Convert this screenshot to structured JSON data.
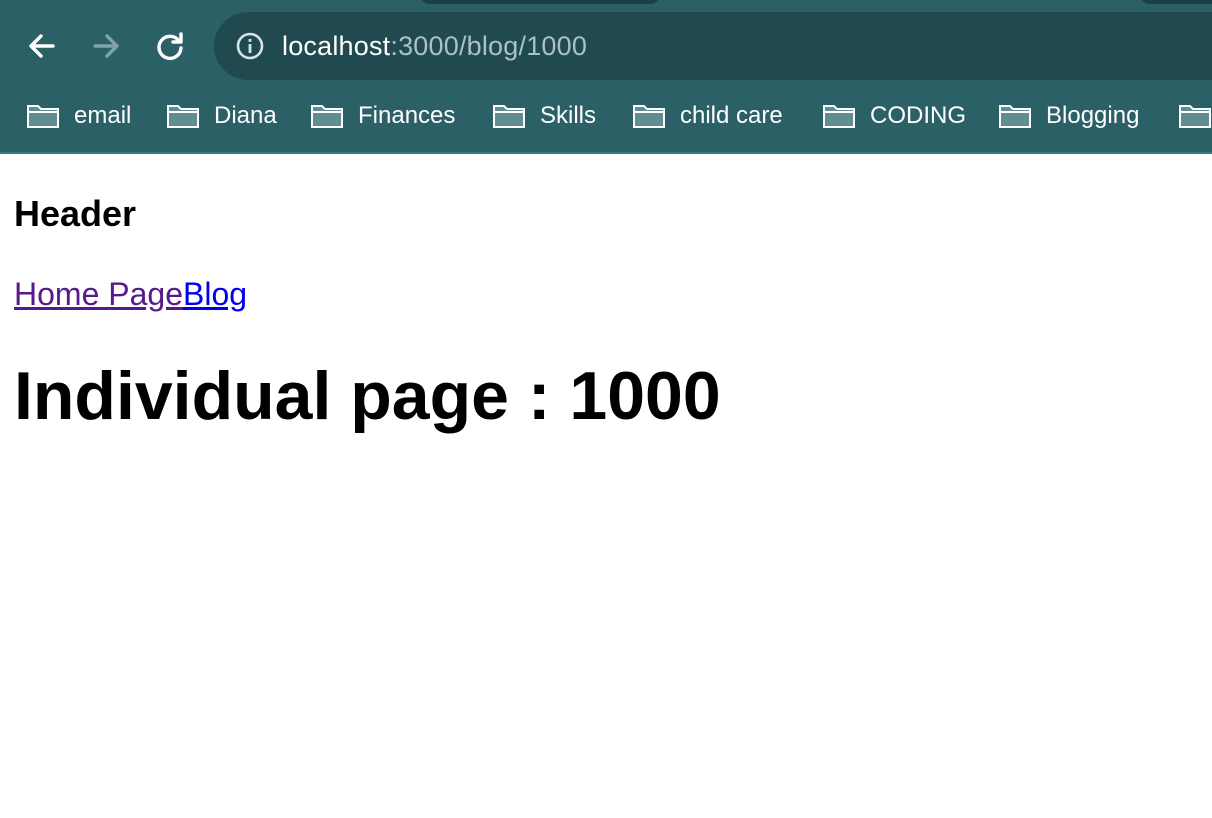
{
  "browser": {
    "address_bar": {
      "host": "localhost",
      "path": ":3000/blog/1000"
    },
    "bookmarks": [
      {
        "label": "email",
        "icon": "folder-icon"
      },
      {
        "label": "Diana",
        "icon": "folder-icon"
      },
      {
        "label": "Finances",
        "icon": "folder-icon"
      },
      {
        "label": "Skills",
        "icon": "folder-icon"
      },
      {
        "label": "child care",
        "icon": "folder-icon"
      },
      {
        "label": "CODING",
        "icon": "folder-icon"
      },
      {
        "label": "Blogging",
        "icon": "folder-icon"
      },
      {
        "label": "",
        "icon": "folder-icon"
      }
    ],
    "colors": {
      "toolbar": "#2b6166",
      "omnibox": "#204a4f"
    }
  },
  "page": {
    "header": "Header",
    "nav": [
      {
        "label": "Home Page",
        "state": "visited",
        "color": "#551a8b"
      },
      {
        "label": "Blog",
        "state": "unvisited",
        "color": "#0000ee"
      }
    ],
    "title": "Individual page : 1000"
  }
}
